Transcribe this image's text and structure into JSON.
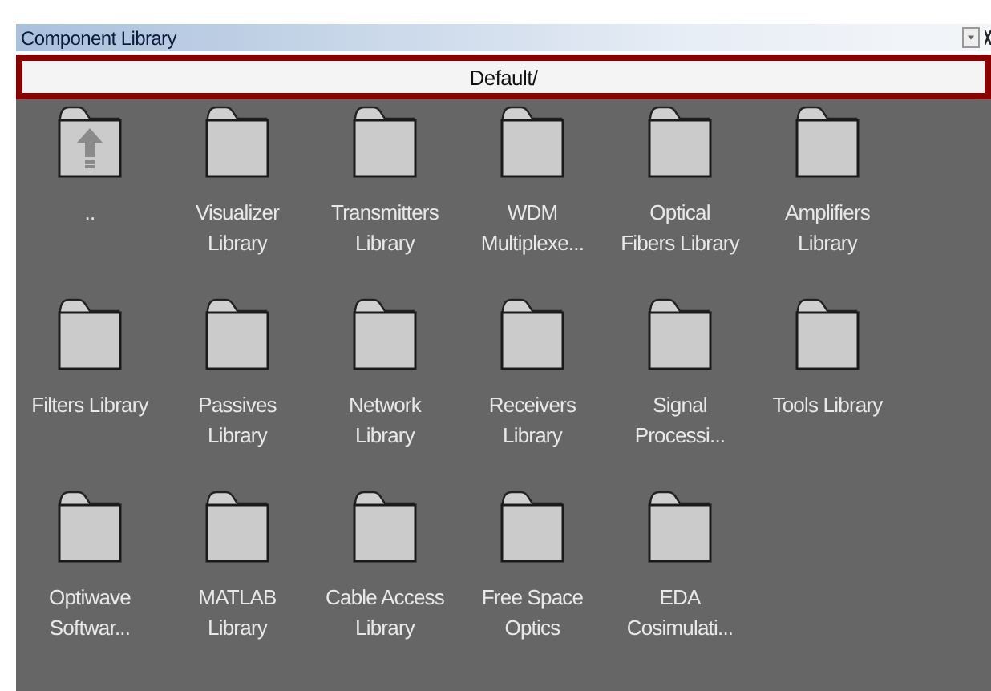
{
  "window": {
    "title": "Component Library"
  },
  "path": "Default/",
  "items": [
    {
      "kind": "up",
      "label": ".."
    },
    {
      "kind": "folder",
      "label": "Visualizer\nLibrary"
    },
    {
      "kind": "folder",
      "label": "Transmitters\nLibrary"
    },
    {
      "kind": "folder",
      "label": "WDM\nMultiplexe..."
    },
    {
      "kind": "folder",
      "label": "Optical\nFibers Library"
    },
    {
      "kind": "folder",
      "label": "Amplifiers\nLibrary"
    },
    {
      "kind": "folder",
      "label": "Filters Library"
    },
    {
      "kind": "folder",
      "label": "Passives\nLibrary"
    },
    {
      "kind": "folder",
      "label": "Network\nLibrary"
    },
    {
      "kind": "folder",
      "label": "Receivers\nLibrary"
    },
    {
      "kind": "folder",
      "label": "Signal\nProcessi..."
    },
    {
      "kind": "folder",
      "label": "Tools Library"
    },
    {
      "kind": "folder",
      "label": "Optiwave\nSoftwar..."
    },
    {
      "kind": "folder",
      "label": "MATLAB\nLibrary"
    },
    {
      "kind": "folder",
      "label": "Cable Access\nLibrary"
    },
    {
      "kind": "folder",
      "label": "Free Space\nOptics"
    },
    {
      "kind": "folder",
      "label": "EDA\nCosimulati..."
    }
  ]
}
